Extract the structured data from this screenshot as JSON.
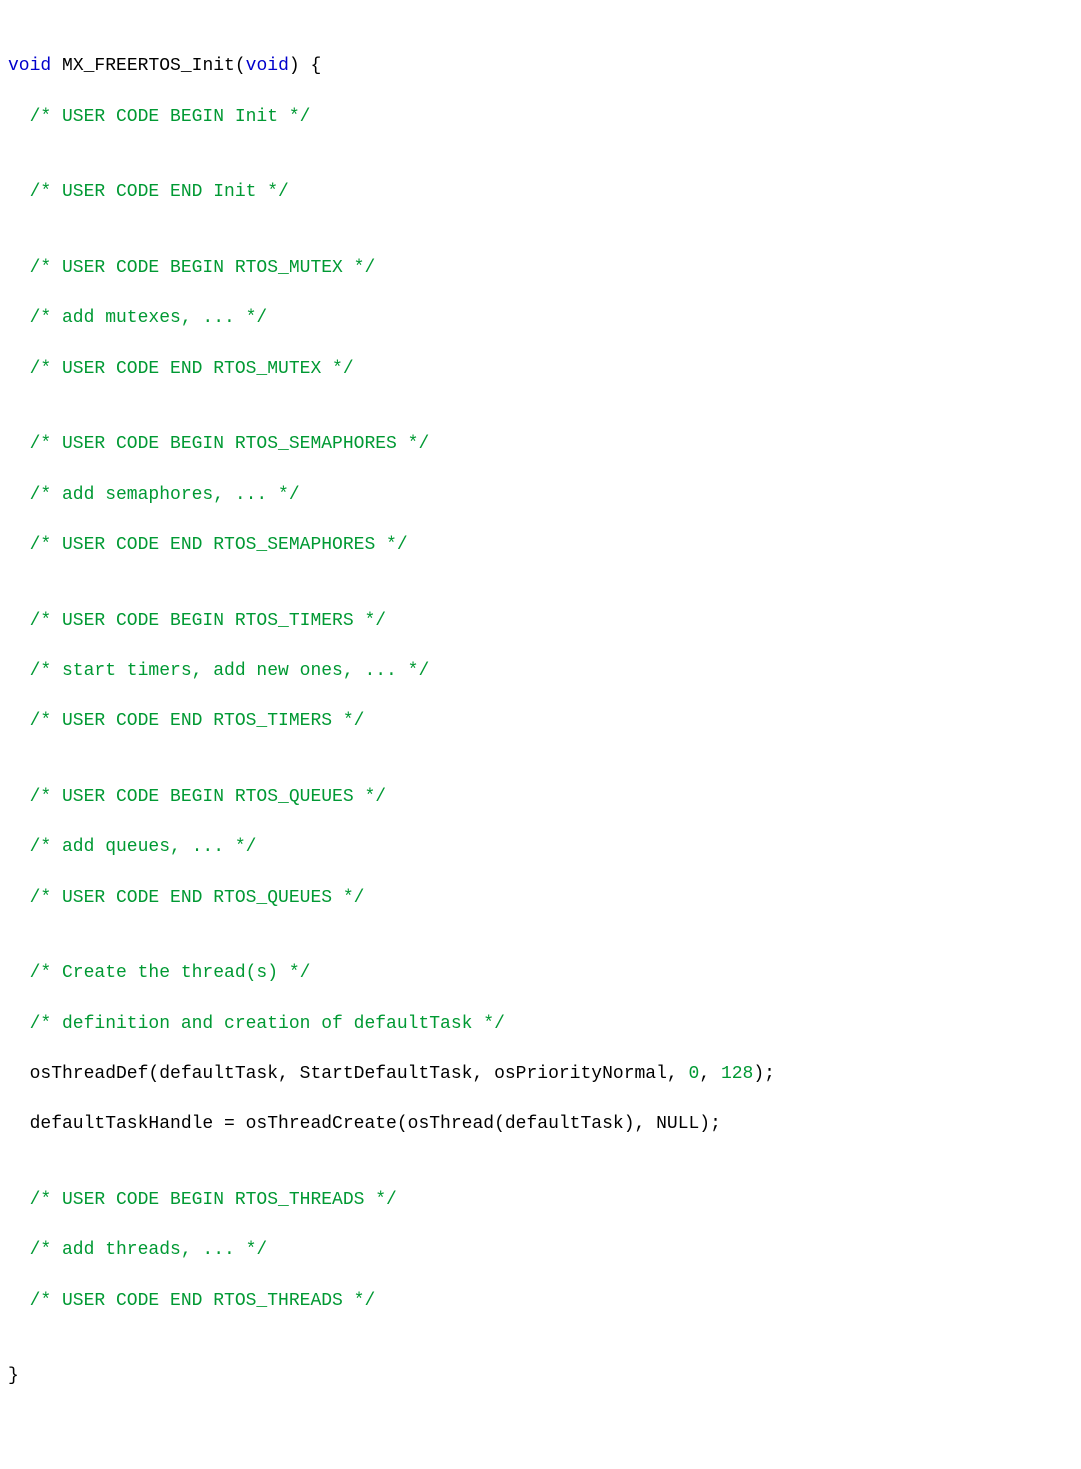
{
  "code": {
    "l01": {
      "kw1": "void",
      "fn": "MX_FREERTOS_Init",
      "paren_open": "(",
      "kw2": "void",
      "paren_close_brace": ") {"
    },
    "l02": "/* USER CODE BEGIN Init */",
    "l03": "",
    "l04": "/* USER CODE END Init */",
    "l05": "",
    "l06": "/* USER CODE BEGIN RTOS_MUTEX */",
    "l07": "/* add mutexes, ... */",
    "l08": "/* USER CODE END RTOS_MUTEX */",
    "l09": "",
    "l10": "/* USER CODE BEGIN RTOS_SEMAPHORES */",
    "l11": "/* add semaphores, ... */",
    "l12": "/* USER CODE END RTOS_SEMAPHORES */",
    "l13": "",
    "l14": "/* USER CODE BEGIN RTOS_TIMERS */",
    "l15": "/* start timers, add new ones, ... */",
    "l16": "/* USER CODE END RTOS_TIMERS */",
    "l17": "",
    "l18": "/* USER CODE BEGIN RTOS_QUEUES */",
    "l19": "/* add queues, ... */",
    "l20": "/* USER CODE END RTOS_QUEUES */",
    "l21": "",
    "l22": "/* Create the thread(s) */",
    "l23": "/* definition and creation of defaultTask */",
    "l24": {
      "p1": "osThreadDef(defaultTask, StartDefaultTask, osPriorityNormal, ",
      "n1": "0",
      "p2": ", ",
      "n2": "128",
      "p3": ");"
    },
    "l25": "defaultTaskHandle = osThreadCreate(osThread(defaultTask), NULL);",
    "l26": "",
    "l27": "/* USER CODE BEGIN RTOS_THREADS */",
    "l28": "/* add threads, ... */",
    "l29": "/* USER CODE END RTOS_THREADS */",
    "l30": "",
    "l31": "}"
  }
}
